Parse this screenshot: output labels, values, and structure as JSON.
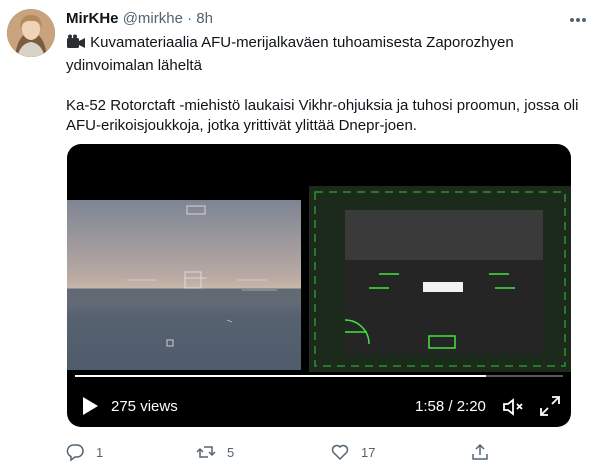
{
  "author": {
    "name": "MirKHe",
    "handle": "@mirkhe",
    "separator": "·",
    "time": "8h"
  },
  "tweet": {
    "line1": "Kuvamateriaalia AFU-merijalkaväen tuhoamisesta Zaporozhyen ydinvoimalan läheltä",
    "line2": "Ka-52 Rotorctaft -miehistö laukaisi Vikhr-ohjuksia ja tuhosi proomun, jossa oli AFU-erikoisjoukkoja, jotka yrittivät ylittää Dnepr-joen."
  },
  "video": {
    "views": "275 views",
    "duration": "1:58 / 2:20",
    "progress": 0.843
  },
  "actions": {
    "reply_count": "1",
    "retweet_count": "5",
    "like_count": "17"
  },
  "icons": {
    "camera": "video-camera-icon",
    "more": "more-icon",
    "reply": "reply-icon",
    "retweet": "retweet-icon",
    "like": "like-icon",
    "share": "share-icon",
    "play": "play-icon",
    "volume": "volume-icon",
    "fullscreen": "fullscreen-icon"
  }
}
